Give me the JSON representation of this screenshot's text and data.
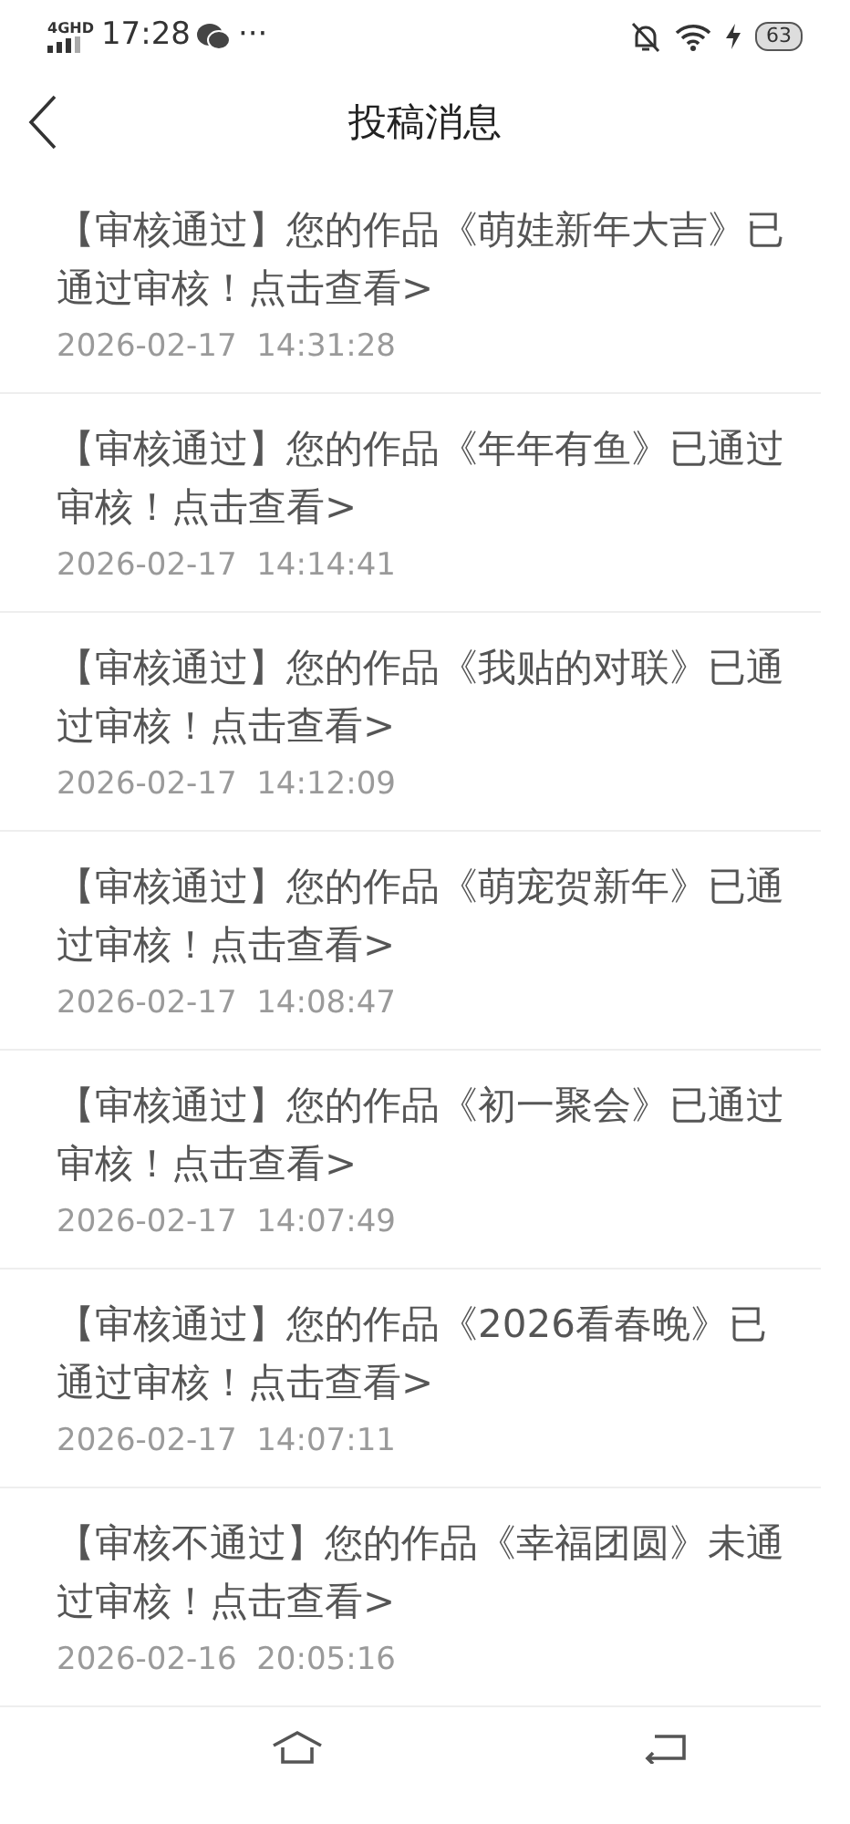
{
  "status_bar": {
    "network": "4G",
    "network_sub": "HD",
    "time": "17:28",
    "more": "···",
    "battery": "63"
  },
  "header": {
    "title": "投稿消息"
  },
  "messages": [
    {
      "text": "【审核通过】您的作品《萌娃新年大吉》已通过审核！点击查看>",
      "time": "2026-02-17  14:31:28"
    },
    {
      "text": "【审核通过】您的作品《年年有鱼》已通过审核！点击查看>",
      "time": "2026-02-17  14:14:41"
    },
    {
      "text": "【审核通过】您的作品《我贴的对联》已通过审核！点击查看>",
      "time": "2026-02-17  14:12:09"
    },
    {
      "text": "【审核通过】您的作品《萌宠贺新年》已通过审核！点击查看>",
      "time": "2026-02-17  14:08:47"
    },
    {
      "text": "【审核通过】您的作品《初一聚会》已通过审核！点击查看>",
      "time": "2026-02-17  14:07:49"
    },
    {
      "text": "【审核通过】您的作品《2026看春晚》已通过审核！点击查看>",
      "time": "2026-02-17  14:07:11"
    },
    {
      "text": "【审核不通过】您的作品《幸福团圆》未通过审核！点击查看>",
      "time": "2026-02-16  20:05:16"
    }
  ]
}
